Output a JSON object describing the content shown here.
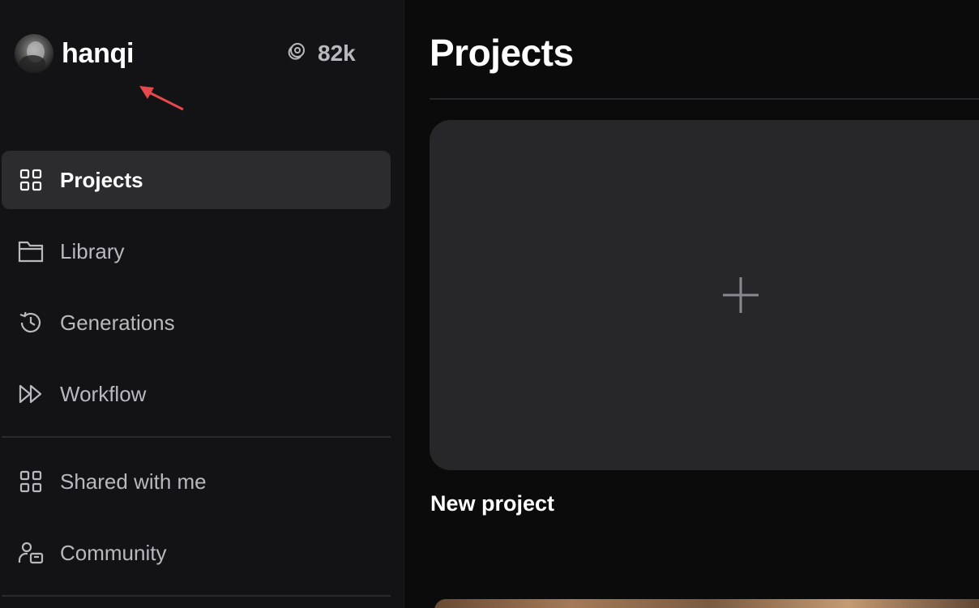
{
  "user": {
    "name": "hanqi",
    "credits": "82k",
    "credits_icon": "coin-icon"
  },
  "sidebar": {
    "items": [
      {
        "label": "Projects",
        "icon": "grid-icon",
        "active": true
      },
      {
        "label": "Library",
        "icon": "folder-icon",
        "active": false
      },
      {
        "label": "Generations",
        "icon": "history-icon",
        "active": false
      },
      {
        "label": "Workflow",
        "icon": "fast-forward-icon",
        "active": false
      },
      {
        "label": "Shared with me",
        "icon": "grid-icon",
        "active": false
      },
      {
        "label": "Community",
        "icon": "users-icon",
        "active": false
      }
    ]
  },
  "main": {
    "title": "Projects",
    "new_project_label": "New project"
  },
  "colors": {
    "sidebar_bg": "#131315",
    "main_bg": "#0b0b0c",
    "active_item_bg": "#2c2c2f",
    "card_bg": "#272729",
    "annotation_arrow": "#e5484d"
  }
}
